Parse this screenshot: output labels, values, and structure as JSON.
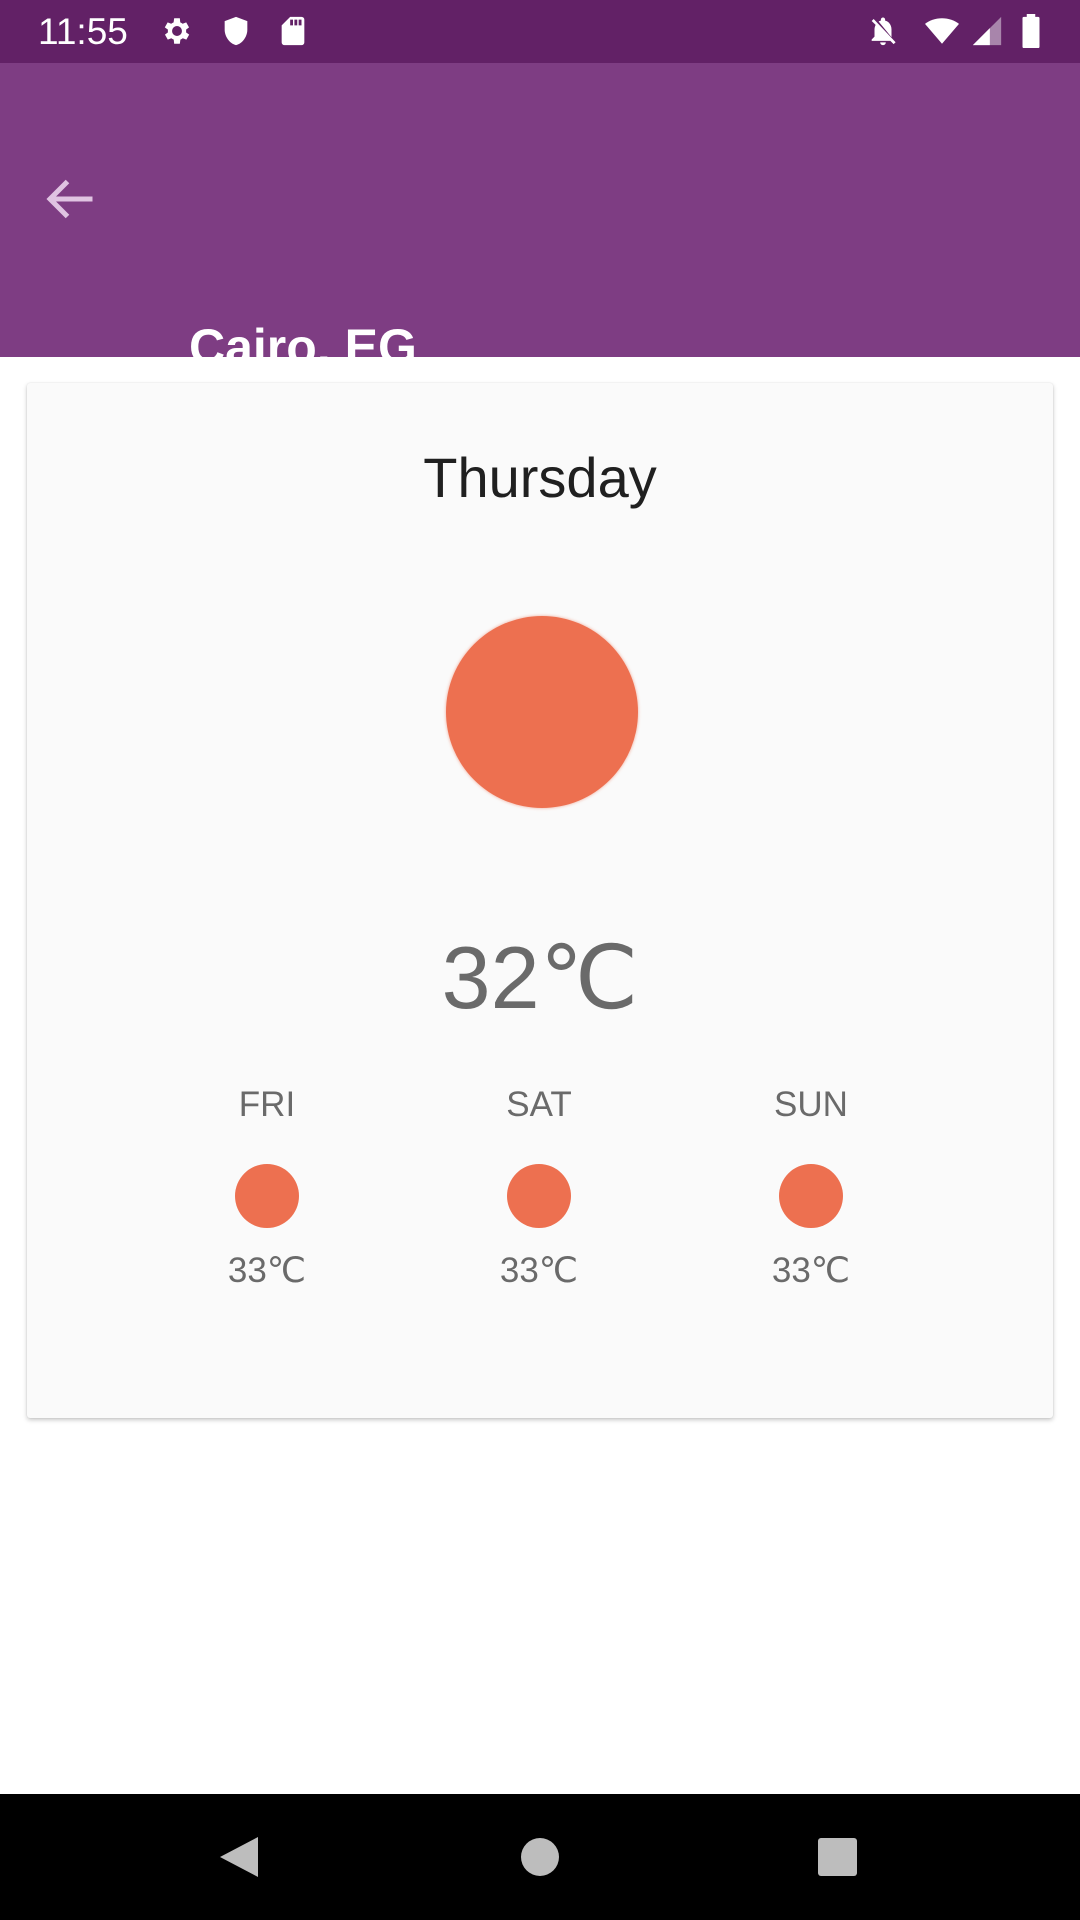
{
  "status_bar": {
    "time": "11:55",
    "left_icons": [
      "gear-icon",
      "shield-icon",
      "sd-card-icon"
    ],
    "right_icons": [
      "notifications-off-icon",
      "wifi-icon",
      "cell-signal-icon",
      "battery-icon"
    ],
    "background": "#622166"
  },
  "app_bar": {
    "title": "Cairo, EG",
    "back_icon": "arrow-back-icon",
    "background": "#7e3d83"
  },
  "today": {
    "day": "Thursday",
    "temperature": "32℃",
    "icon": "sun-icon"
  },
  "forecast": [
    {
      "day": "FRI",
      "temperature": "33℃",
      "icon": "sun-icon"
    },
    {
      "day": "SAT",
      "temperature": "33℃",
      "icon": "sun-icon"
    },
    {
      "day": "SUN",
      "temperature": "33℃",
      "icon": "sun-icon"
    }
  ],
  "colors": {
    "sun": "#ed7050",
    "card": "#fafafa"
  },
  "nav_bar": {
    "buttons": [
      "back-triangle-icon",
      "home-circle-icon",
      "recents-square-icon"
    ]
  }
}
